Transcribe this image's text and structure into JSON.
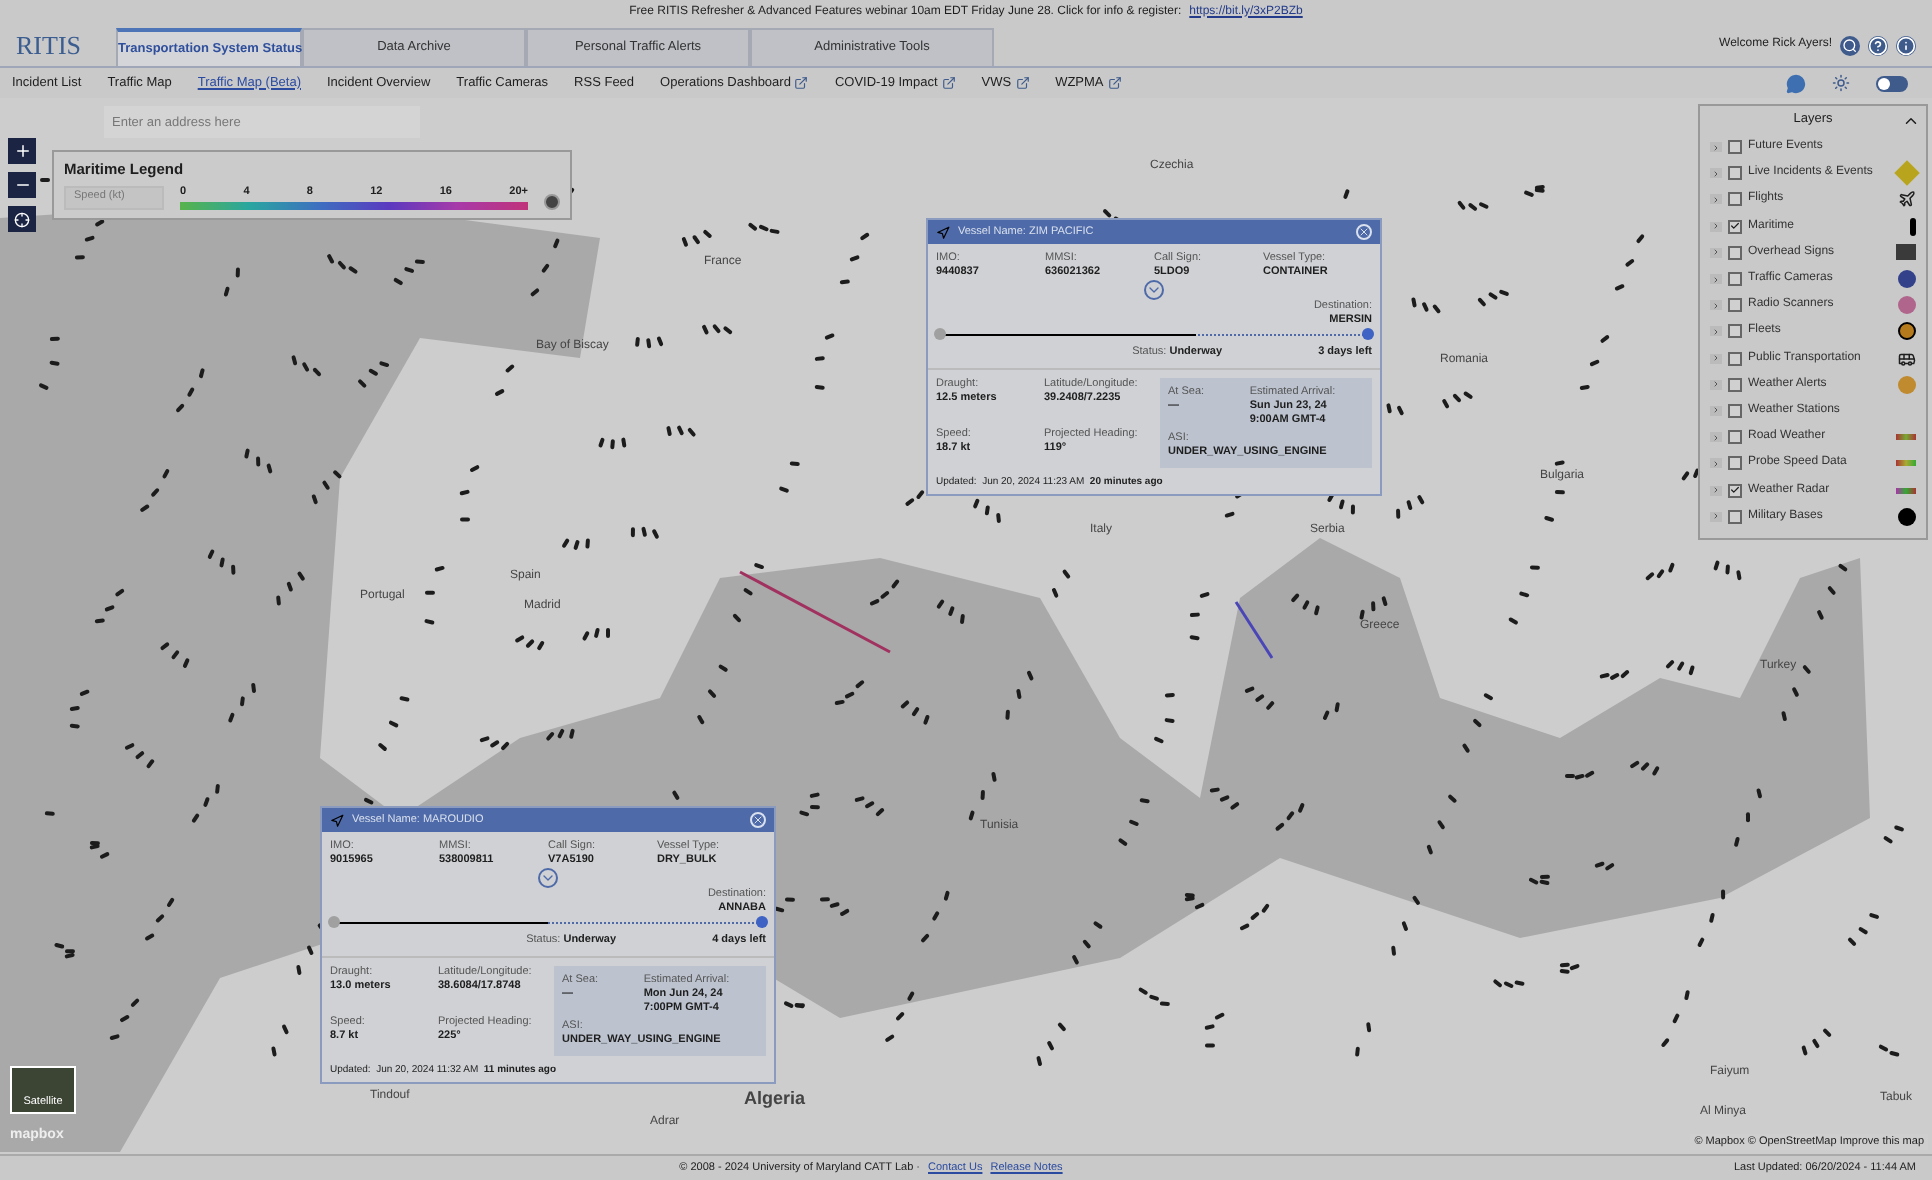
{
  "banner": {
    "text": "Free RITIS Refresher & Advanced Features webinar 10am EDT Friday June 28. Click for info & register:",
    "link": "https://bit.ly/3xP2BZb"
  },
  "logo": "RITIS",
  "tabs": [
    {
      "label": "Transportation System Status",
      "selected": true
    },
    {
      "label": "Data Archive",
      "selected": false
    },
    {
      "label": "Personal Traffic Alerts",
      "selected": false
    },
    {
      "label": "Administrative Tools",
      "selected": false
    }
  ],
  "welcome": "Welcome Rick Ayers!",
  "dark_mode": false,
  "nav": [
    {
      "label": "Incident List",
      "selected": false,
      "external": false
    },
    {
      "label": "Traffic Map",
      "selected": false,
      "external": false
    },
    {
      "label": "Traffic Map (Beta)",
      "selected": true,
      "external": false
    },
    {
      "label": "Incident Overview",
      "selected": false,
      "external": false
    },
    {
      "label": "Traffic Cameras",
      "selected": false,
      "external": false
    },
    {
      "label": "RSS Feed",
      "selected": false,
      "external": false
    },
    {
      "label": "Operations Dashboard",
      "selected": false,
      "external": true
    },
    {
      "label": "COVID-19 Impact",
      "selected": false,
      "external": true
    },
    {
      "label": "VWS",
      "selected": false,
      "external": true
    },
    {
      "label": "WZPMA",
      "selected": false,
      "external": true
    }
  ],
  "map": {
    "search": {
      "placeholder": "Enter an address here"
    },
    "labels": [
      "Czechia",
      "France",
      "Bay of Biscay",
      "Romania",
      "Serbia",
      "Bulgaria",
      "Spain",
      "Madrid",
      "Portugal",
      "Italy",
      "Greece",
      "Turkey",
      "Tunisia",
      "Tindouf",
      "Algeria",
      "Adrar",
      "Faiyum",
      "Al Minya",
      "Tabuk"
    ],
    "legend": {
      "title": "Maritime Legend",
      "field": "Speed (kt)",
      "ticks": [
        "0",
        "4",
        "8",
        "12",
        "16",
        "20+"
      ]
    },
    "vessels": [
      {
        "name_label": "Vessel Name:",
        "name": "ZIM PACIFIC",
        "top": [
          {
            "label": "IMO:",
            "value": "9440837"
          },
          {
            "label": "MMSI:",
            "value": "636021362"
          },
          {
            "label": "Call Sign:",
            "value": "5LDO9"
          },
          {
            "label": "Vessel Type:",
            "value": "CONTAINER"
          }
        ],
        "destination_label": "Destination:",
        "destination": "MERSIN",
        "level": 0.6,
        "status_label": "Status:",
        "status": "Underway",
        "remaining": "3 days left",
        "details": [
          {
            "label": "Draught:",
            "value": "12.5 meters"
          },
          {
            "label": "Latitude/Longitude:",
            "value": "39.2408/7.2235"
          },
          {
            "label": "Speed:",
            "value": "18.7 kt"
          },
          {
            "label": "Projected Heading:",
            "value": "119°"
          }
        ],
        "at_sea_label": "At Sea:",
        "at_sea": "—",
        "arrival_label": "Estimated Arrival:",
        "arrival": [
          "Sun Jun 23, 24",
          "9:00AM GMT-4"
        ],
        "asi_label": "ASI:",
        "asi": "UNDER_WAY_USING_ENGINE",
        "updated": "Updated:  Jun 20, 2024 11:23 AM  **20 minutes ago**"
      },
      {
        "name_label": "Vessel Name:",
        "name": "MAROUDIO",
        "top": [
          {
            "label": "IMO:",
            "value": "9015965"
          },
          {
            "label": "MMSI:",
            "value": "538009811"
          },
          {
            "label": "Call Sign:",
            "value": "V7A5190"
          },
          {
            "label": "Vessel Type:",
            "value": "DRY_BULK"
          }
        ],
        "destination_label": "Destination:",
        "destination": "ANNABA",
        "level": 0.5,
        "status_label": "Status:",
        "status": "Underway",
        "remaining": "4 days left",
        "details": [
          {
            "label": "Draught:",
            "value": "13.0 meters"
          },
          {
            "label": "Latitude/Longitude:",
            "value": "38.6084/17.8748"
          },
          {
            "label": "Speed:",
            "value": "8.7 kt"
          },
          {
            "label": "Projected Heading:",
            "value": "225°"
          }
        ],
        "at_sea_label": "At Sea:",
        "at_sea": "—",
        "arrival_label": "Estimated Arrival:",
        "arrival": [
          "Mon Jun 24, 24",
          "7:00PM GMT-4"
        ],
        "asi_label": "ASI:",
        "asi": "UNDER_WAY_USING_ENGINE",
        "updated": "Updated:  Jun 20, 2024 11:32 AM  **11 minutes ago**"
      }
    ],
    "layers": {
      "title": "Layers",
      "items": [
        {
          "label": "Future Events",
          "checked": false
        },
        {
          "label": "Live Incidents & Events",
          "checked": false
        },
        {
          "label": "Flights",
          "checked": false
        },
        {
          "label": "Maritime",
          "checked": true
        },
        {
          "label": "Overhead Signs",
          "checked": false
        },
        {
          "label": "Traffic Cameras",
          "checked": false
        },
        {
          "label": "Radio Scanners",
          "checked": false
        },
        {
          "label": "Fleets",
          "checked": false
        },
        {
          "label": "Public Transportation",
          "checked": false
        },
        {
          "label": "Weather Alerts",
          "checked": false
        },
        {
          "label": "Weather Stations",
          "checked": false
        },
        {
          "label": "Road Weather",
          "checked": false
        },
        {
          "label": "Probe Speed Data",
          "checked": false
        },
        {
          "label": "Weather Radar",
          "checked": true
        },
        {
          "label": "Military Bases",
          "checked": false
        }
      ]
    },
    "satellite": "Satellite",
    "mapbox": "mapbox",
    "attribution": "© Mapbox © OpenStreetMap Improve this map"
  },
  "footer": {
    "copyright": "© 2008 - 2024 University of Maryland CATT Lab ·",
    "links": [
      "Contact Us",
      "Release Notes"
    ],
    "last_updated": "Last Updated: 06/20/2024 - 11:44 AM"
  }
}
